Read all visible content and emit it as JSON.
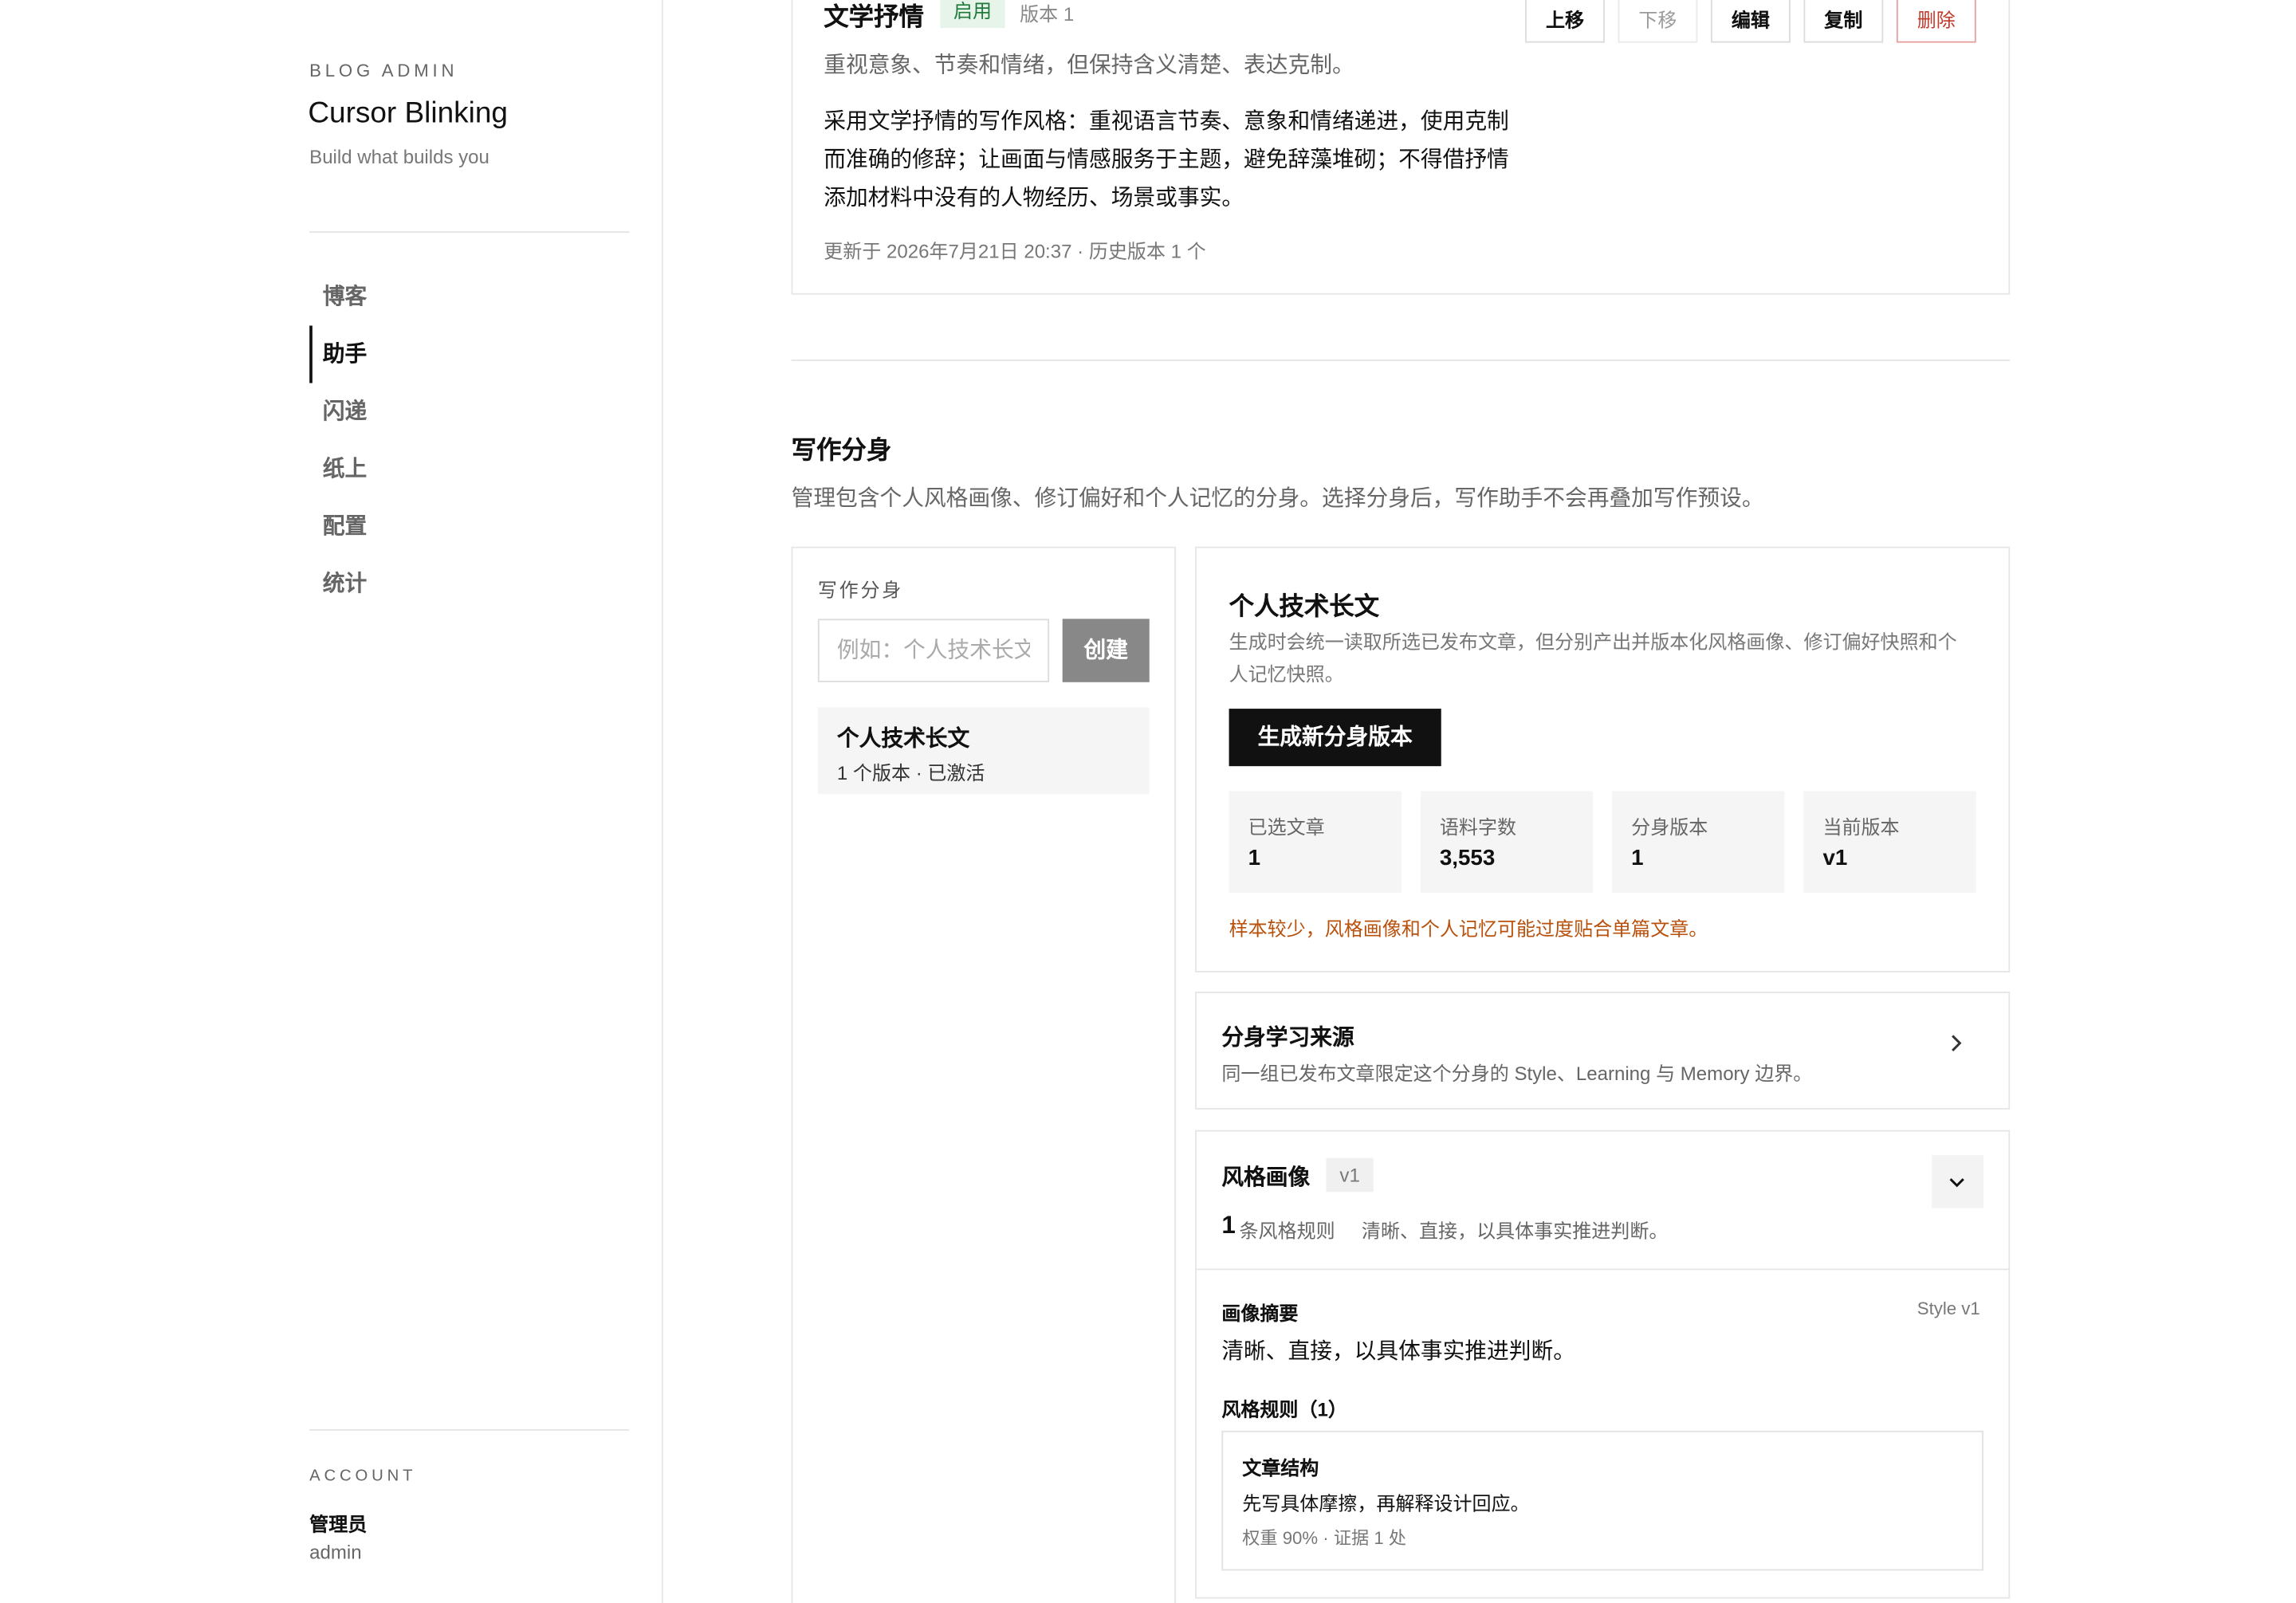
{
  "sidebar": {
    "brand_small": "BLOG ADMIN",
    "brand_title": "Cursor Blinking",
    "brand_subtitle": "Build what builds you",
    "nav": [
      {
        "label": "博客",
        "active": false
      },
      {
        "label": "助手",
        "active": true
      },
      {
        "label": "闪递",
        "active": false
      },
      {
        "label": "纸上",
        "active": false
      },
      {
        "label": "配置",
        "active": false
      },
      {
        "label": "统计",
        "active": false
      }
    ],
    "account": {
      "label": "ACCOUNT",
      "name": "管理员",
      "username": "admin"
    }
  },
  "preset_card": {
    "title": "文学抒情",
    "status_badge": "启用",
    "version": "版本 1",
    "actions": {
      "move_up": "上移",
      "move_down": "下移",
      "edit": "编辑",
      "copy": "复制",
      "delete": "删除"
    },
    "description": "重视意象、节奏和情绪，但保持含义清楚、表达克制。",
    "body": "采用文学抒情的写作风格：重视语言节奏、意象和情绪递进，使用克制而准确的修辞；让画面与情感服务于主题，避免辞藻堆砌；不得借抒情添加材料中没有的人物经历、场景或事实。",
    "meta": "更新于 2026年7月21日 20:37 · 历史版本 1 个"
  },
  "persona_section": {
    "title": "写作分身",
    "description": "管理包含个人风格画像、修订偏好和个人记忆的分身。选择分身后，写作助手不会再叠加写作预设。",
    "list_panel": {
      "label": "写作分身",
      "input_placeholder": "例如：个人技术长文",
      "input_value": "",
      "create_button": "创建",
      "items": [
        {
          "name": "个人技术长文",
          "meta": "1 个版本 · 已激活"
        }
      ]
    },
    "detail": {
      "title": "个人技术长文",
      "description": "生成时会统一读取所选已发布文章，但分别产出并版本化风格画像、修订偏好快照和个人记忆快照。",
      "generate_button": "生成新分身版本",
      "stats": [
        {
          "label": "已选文章",
          "value": "1"
        },
        {
          "label": "语料字数",
          "value": "3,553"
        },
        {
          "label": "分身版本",
          "value": "1"
        },
        {
          "label": "当前版本",
          "value": "v1"
        }
      ],
      "warning": "样本较少，风格画像和个人记忆可能过度贴合单篇文章。",
      "warning_color": "#b8510c"
    },
    "source_card": {
      "title": "分身学习来源",
      "description": "同一组已发布文章限定这个分身的 Style、Learning 与 Memory 边界。",
      "icon": "chevron-right-icon"
    },
    "style_card": {
      "title": "风格画像",
      "version_badge": "v1",
      "toggle_icon": "chevron-down-icon",
      "rule_count": "1",
      "rule_count_label": "条风格规则",
      "summary_inline": "清晰、直接，以具体事实推进判断。",
      "profile": {
        "label": "画像摘要",
        "version": "Style v1",
        "summary": "清晰、直接，以具体事实推进判断。"
      },
      "rules_label": "风格规则（1）",
      "rules": [
        {
          "category": "文章结构",
          "text": "先写具体摩擦，再解释设计回应。",
          "meta": "权重 90% · 证据 1 处"
        }
      ]
    }
  }
}
